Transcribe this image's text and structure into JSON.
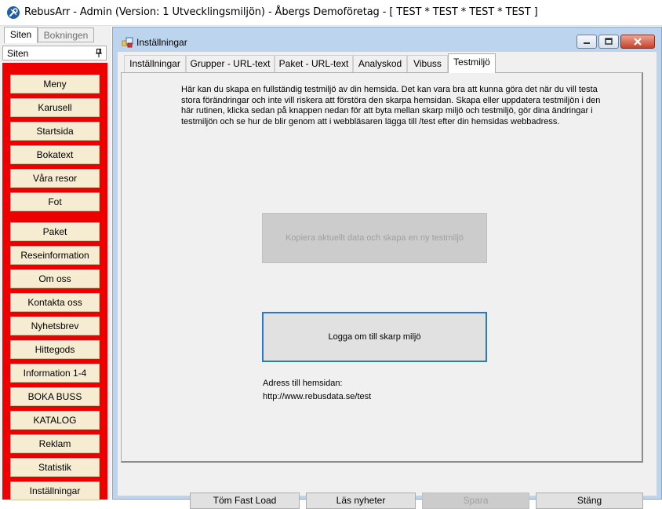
{
  "window": {
    "title": "RebusArr - Admin  (Version: 1  Utvecklingsmiljön) - Åbergs Demoföretag - [ TEST * TEST * TEST * TEST ]"
  },
  "left_tabs": [
    {
      "label": "Siten",
      "active": true
    },
    {
      "label": "Bokningen",
      "active": false
    }
  ],
  "siten_panel": {
    "title": "Siten",
    "items": [
      "Meny",
      "Karusell",
      "Startsida",
      "Bokatext",
      "Våra resor",
      "Fot",
      "Paket",
      "Reseinformation",
      "Om oss",
      "Kontakta oss",
      "Nyhetsbrev",
      "Hittegods",
      "Information 1-4",
      "BOKA BUSS",
      "KATALOG",
      "Reklam",
      "Statistik",
      "Inställningar"
    ]
  },
  "child_window": {
    "title": "Inställningar",
    "tabs": [
      {
        "label": "Inställningar",
        "active": false
      },
      {
        "label": "Grupper - URL-text",
        "active": false
      },
      {
        "label": "Paket - URL-text",
        "active": false
      },
      {
        "label": "Analyskod",
        "active": false
      },
      {
        "label": "Vibuss",
        "active": false
      },
      {
        "label": "Testmiljö",
        "active": true
      }
    ],
    "testmiljo": {
      "description": "Här kan du skapa en fullständig testmiljö av din hemsida. Det kan vara bra att kunna göra det när du vill testa stora förändringar och inte vill riskera att förstöra den skarpa hemsidan. Skapa eller uppdatera testmiljön i den här rutinen, klicka sedan på knappen nedan för att byta mellan skarp miljö och testmiljö, gör dina ändringar i testmiljön och se hur de blir genom att i webbläsaren lägga till /test efter din hemsidas webbadress.",
      "copy_button": "Kopiera aktuellt data och skapa en ny testmiljö",
      "switch_button": "Logga om till skarp miljö",
      "address_label": "Adress till hemsidan:",
      "address_url": "http://www.rebusdata.se/test"
    },
    "bottom_buttons": {
      "clear_fast_load": "Töm Fast Load",
      "read_news": "Läs nyheter",
      "save": "Spara",
      "close": "Stäng"
    }
  },
  "colors": {
    "menu_panel": "#ee0000",
    "menu_button": "#f5ecd2",
    "mdi_frame": "#bcd4ee",
    "focus_border": "#2a78c8"
  }
}
